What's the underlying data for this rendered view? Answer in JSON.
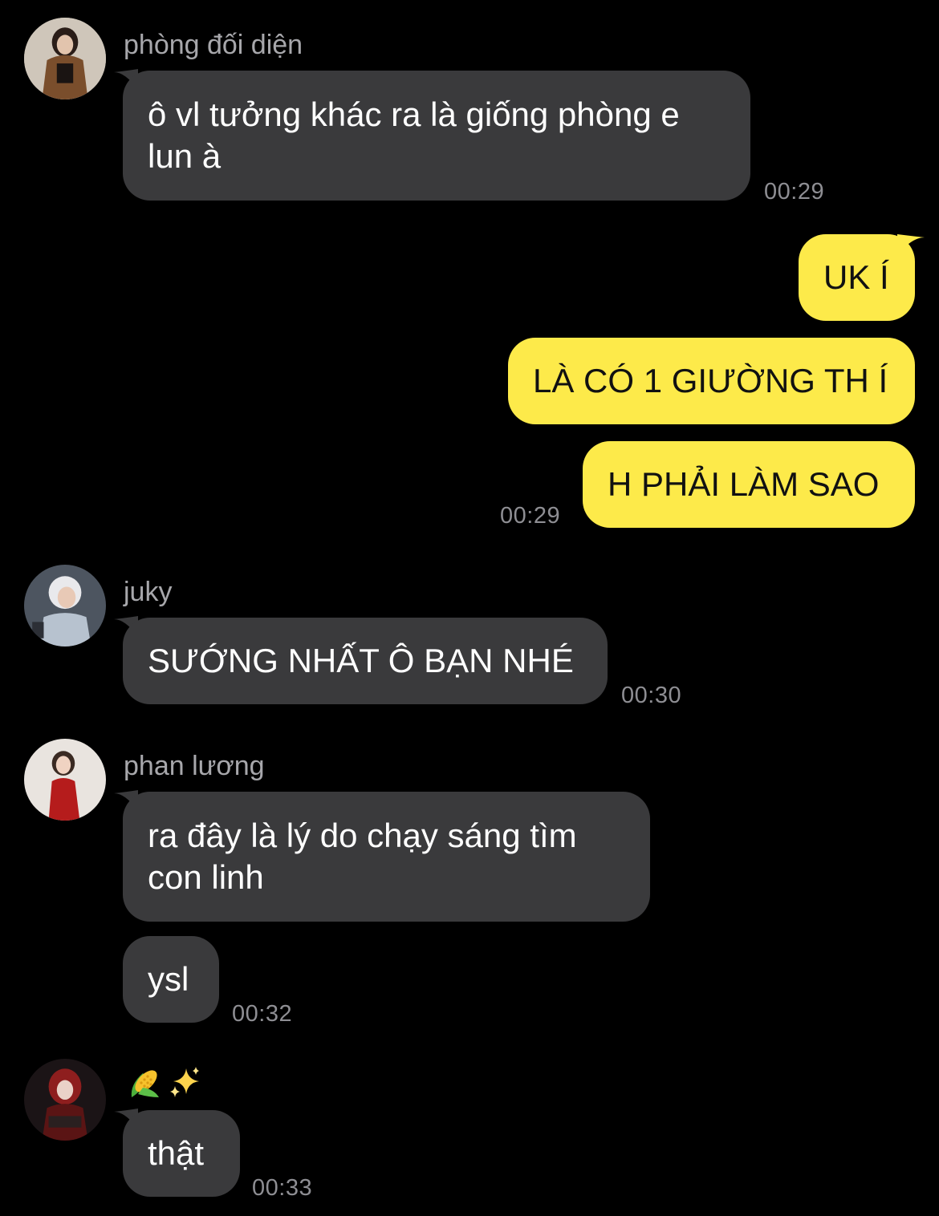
{
  "colors": {
    "background": "#000000",
    "incoming_bubble": "#3a3a3c",
    "outgoing_bubble": "#fdea4a",
    "sender_name": "#a7a7ab",
    "timestamp": "#8e8e93"
  },
  "groups": [
    {
      "sender": "phòng đối diện",
      "avatar": "avatar-photo",
      "messages": [
        "ô vl tưởng khác ra là giống phòng e\nlun à"
      ],
      "time": "00:29"
    },
    {
      "sender": "",
      "outgoing": true,
      "messages": [
        "UK Í",
        "LÀ CÓ 1 GIƯỜNG TH Í",
        "H PHẢI LÀM SAO"
      ],
      "time": "00:29"
    },
    {
      "sender": "juky",
      "avatar": "avatar-photo",
      "messages": [
        "SƯỚNG NHẤT Ô BẠN NHÉ"
      ],
      "time": "00:30"
    },
    {
      "sender": "phan lương",
      "avatar": "avatar-photo",
      "messages": [
        "ra đây là lý do chạy sáng tìm\ncon linh",
        "ysl"
      ],
      "time": "00:32"
    },
    {
      "sender_icons": [
        "corn-emoji-icon",
        "sparkles-emoji-icon"
      ],
      "avatar": "avatar-photo",
      "messages": [
        "thật"
      ],
      "time": "00:33"
    }
  ]
}
